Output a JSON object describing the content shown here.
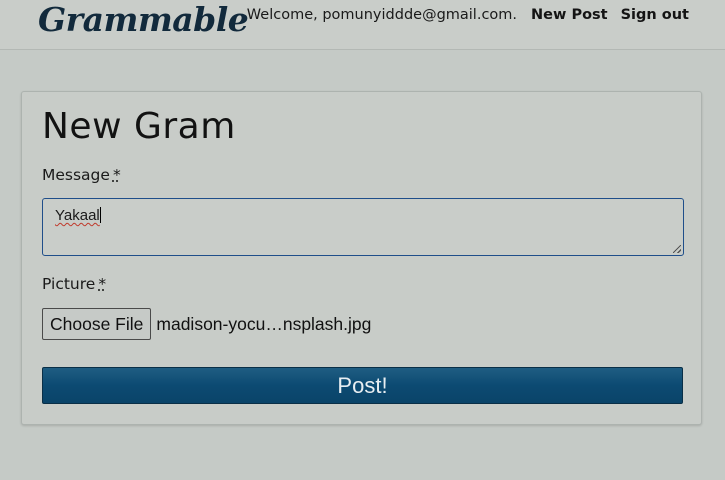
{
  "header": {
    "brand": "Grammable",
    "welcome": "Welcome, pomunyiddde@gmail.com.",
    "new_post": "New Post",
    "sign_out": "Sign out"
  },
  "form": {
    "title": "New Gram",
    "message_label": "Message",
    "required_mark": "*",
    "message_value": "Yakaal",
    "picture_label": "Picture",
    "file_button": "Choose File",
    "file_name": "madison-yocu…nsplash.jpg",
    "submit": "Post!"
  },
  "colors": {
    "brand": "#122a3c",
    "submit_bg": "#0c4a72",
    "input_border": "#1f4e8a",
    "spellcheck": "#c0392b"
  }
}
